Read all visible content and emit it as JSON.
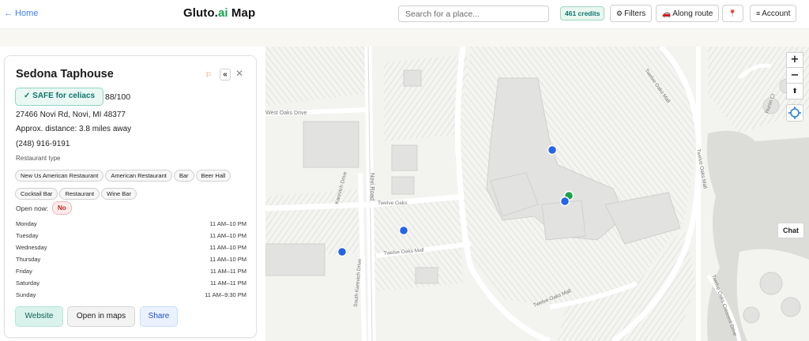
{
  "header": {
    "home_label": "← Home",
    "brand_prefix": "Gluto.",
    "brand_accent": "ai",
    "brand_suffix": " Map",
    "search_placeholder": "Search for a place...",
    "credits": "461 credits",
    "filters_icon": "⚙",
    "filters_label": "Filters",
    "route_icon": "🚗",
    "route_label": "Along route",
    "pin_icon": "📍",
    "account_icon": "≡",
    "account_label": "Account"
  },
  "map": {
    "zoom_in": "+",
    "zoom_out": "−",
    "compass": "⬆",
    "chat_label": "Chat",
    "streets": [
      "West Oaks Drive",
      "Novi Road",
      "Karevich Drive",
      "Twelve Oaks",
      "Twelve Oaks Mall",
      "Twelve Oaks Mall",
      "South Karevich Drive",
      "Twelve Oaks Mall",
      "Twelve Oaks Mall",
      "Huron Ct",
      "Twelve Oaks Crescent Drive"
    ],
    "markers": [
      {
        "type": "blue",
        "label": "place"
      },
      {
        "type": "blue",
        "label": "place"
      },
      {
        "type": "blue",
        "label": "place"
      },
      {
        "type": "blue",
        "label": "place"
      },
      {
        "type": "green",
        "label": "selected"
      }
    ]
  },
  "place": {
    "name": "Sedona Taphouse",
    "flag_icon": "⚐",
    "collapse_icon": "«",
    "close_icon": "✕",
    "safety_label": "✓ SAFE for celiacs",
    "score": "88/100",
    "address": "27466 Novi Rd, Novi, MI 48377",
    "distance": "Approx. distance: 3.8 miles away",
    "phone": "(248) 916-9191",
    "type_label": "Restaurant type",
    "types": [
      "New Us American Restaurant",
      "American Restaurant",
      "Bar",
      "Beer Hall",
      "Cocktail Bar",
      "Restaurant",
      "Wine Bar"
    ],
    "open_label": "Open now:",
    "open_value": "No",
    "hours": [
      {
        "day": "Monday",
        "time": "11 AM–10 PM"
      },
      {
        "day": "Tuesday",
        "time": "11 AM–10 PM"
      },
      {
        "day": "Wednesday",
        "time": "11 AM–10 PM"
      },
      {
        "day": "Thursday",
        "time": "11 AM–10 PM"
      },
      {
        "day": "Friday",
        "time": "11 AM–11 PM"
      },
      {
        "day": "Saturday",
        "time": "11 AM–11 PM"
      },
      {
        "day": "Sunday",
        "time": "11 AM–9:30 PM"
      }
    ],
    "actions": {
      "website": "Website",
      "open_maps": "Open in maps",
      "share": "Share"
    }
  },
  "colors": {
    "accent": "#16a34a",
    "link": "#3b82f6",
    "marker_blue": "#2563eb",
    "marker_green": "#16a34a"
  }
}
